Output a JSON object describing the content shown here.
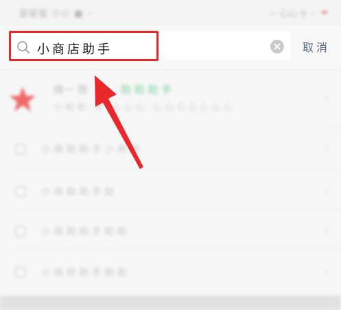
{
  "status_bar": {
    "left_text": "留留留 小小 ■ ◦",
    "right_text": "☆ 心心 ⚲ ◦"
  },
  "search": {
    "query": "小商店助手",
    "cancel_label": "取消"
  },
  "top_result": {
    "title": "微一 微",
    "tag": "助 助 助 手",
    "description": "小 助 助 ·  开 · 心 心 心 · 心 心 心 心 心 心 心"
  },
  "results": [
    {
      "label": "小 商 助 助 手 小 商 助"
    },
    {
      "label": "小 商 助 助 手 助"
    },
    {
      "label": "小 商 助 助 手 助 助"
    },
    {
      "label": "小 商 助 助 手 助 助"
    }
  ],
  "colors": {
    "highlight": "#e8282b",
    "arrow": "#e8282b",
    "cancel": "#5a6b85"
  },
  "icons": {
    "search": "search-icon",
    "clear": "clear-icon",
    "result": "star-icon",
    "annotation": "arrow-icon"
  }
}
